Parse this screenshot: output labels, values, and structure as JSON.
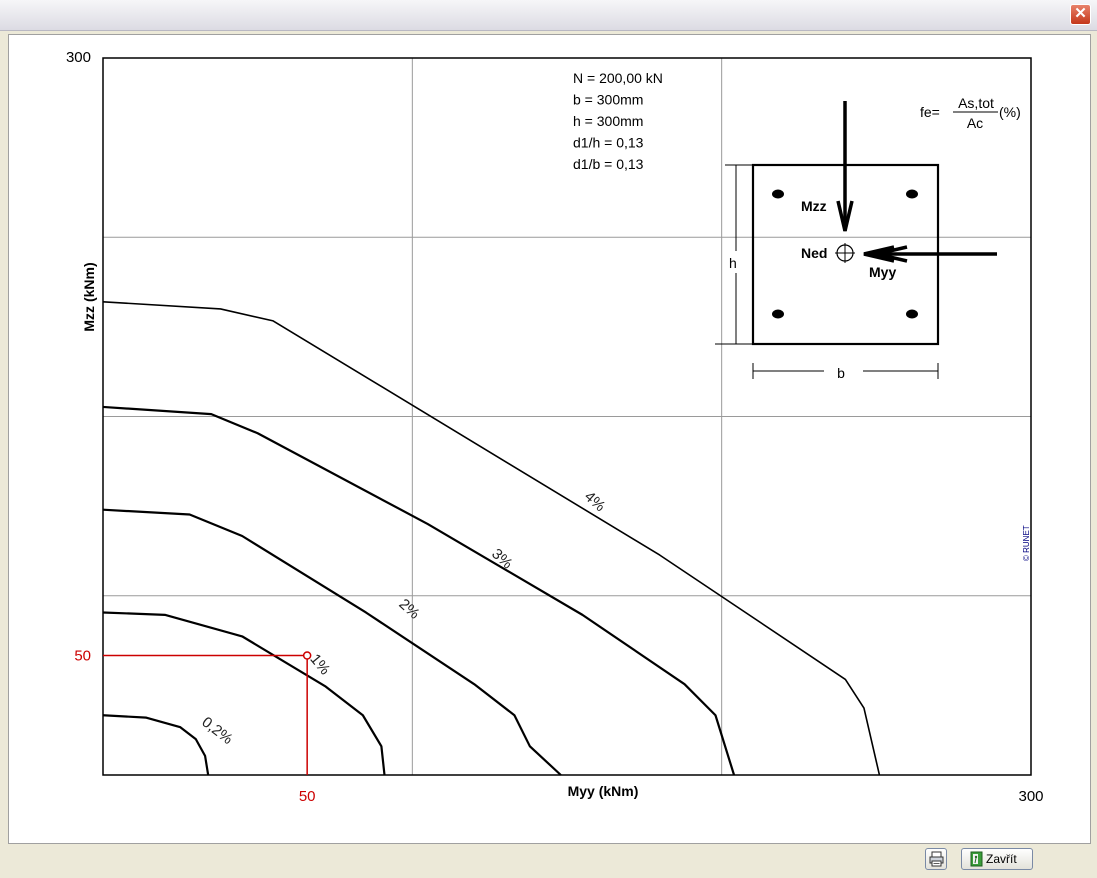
{
  "window": {
    "close_glyph": "✕"
  },
  "chart_data": {
    "type": "line",
    "xlabel": "Myy (kNm)",
    "ylabel": "Mzz (kNm)",
    "xlim": [
      0,
      300
    ],
    "ylim": [
      0,
      300
    ],
    "x_ticks": [
      "300"
    ],
    "y_ticks": [
      "300"
    ],
    "grid": true,
    "grid_x": [
      100,
      200,
      300
    ],
    "grid_y": [
      75,
      150,
      225,
      300
    ],
    "series": [
      {
        "name": "0,2%",
        "points": [
          [
            0,
            25
          ],
          [
            14,
            24
          ],
          [
            25,
            20
          ],
          [
            30,
            15
          ],
          [
            33,
            8
          ],
          [
            34,
            0
          ]
        ]
      },
      {
        "name": "1%",
        "points": [
          [
            0,
            68
          ],
          [
            20,
            67
          ],
          [
            45,
            58
          ],
          [
            72,
            37
          ],
          [
            84,
            25
          ],
          [
            90,
            12
          ],
          [
            91,
            0
          ]
        ]
      },
      {
        "name": "2%",
        "points": [
          [
            0,
            111
          ],
          [
            28,
            109
          ],
          [
            45,
            100
          ],
          [
            85,
            68
          ],
          [
            120,
            38
          ],
          [
            133,
            25
          ],
          [
            138,
            12
          ],
          [
            148,
            0
          ]
        ]
      },
      {
        "name": "3%",
        "points": [
          [
            0,
            154
          ],
          [
            35,
            151
          ],
          [
            50,
            143
          ],
          [
            105,
            105
          ],
          [
            155,
            67
          ],
          [
            188,
            38
          ],
          [
            198,
            25
          ],
          [
            204,
            0
          ]
        ]
      },
      {
        "name": "4%",
        "points": [
          [
            0,
            198
          ],
          [
            38,
            195
          ],
          [
            55,
            190
          ],
          [
            180,
            92
          ],
          [
            240,
            40
          ],
          [
            246,
            28
          ],
          [
            251,
            0
          ]
        ]
      }
    ],
    "series_labels": [
      {
        "text": "0,2%",
        "x": 36,
        "y": 17,
        "rotate": 38
      },
      {
        "text": "1%",
        "x": 69,
        "y": 45,
        "rotate": 50
      },
      {
        "text": "2%",
        "x": 98,
        "y": 68,
        "rotate": 42
      },
      {
        "text": "3%",
        "x": 128,
        "y": 89,
        "rotate": 42
      },
      {
        "text": "4%",
        "x": 158,
        "y": 113,
        "rotate": 42
      }
    ],
    "marker": {
      "x": 66,
      "y": 50,
      "x_label": "50",
      "y_label": "50",
      "color": "#cc0000"
    },
    "annotations": {
      "parameters": [
        "N = 200,00 kN",
        "b = 300mm",
        "h = 300mm",
        "d1/h = 0,13",
        "d1/b = 0,13"
      ],
      "formula_prefix": "fe=",
      "formula_numerator": "As,tot",
      "formula_denominator": "Ac",
      "formula_suffix": "(%)",
      "section_labels": {
        "mzz": "Mzz",
        "myy": "Myy",
        "ned": "Ned",
        "h": "h",
        "b": "b"
      },
      "watermark": "© RUNET",
      "watermark_color": "#000080"
    }
  },
  "footer": {
    "print_icon": "printer-icon",
    "close_label": "Zavřít",
    "close_icon": "exit-door-icon"
  }
}
